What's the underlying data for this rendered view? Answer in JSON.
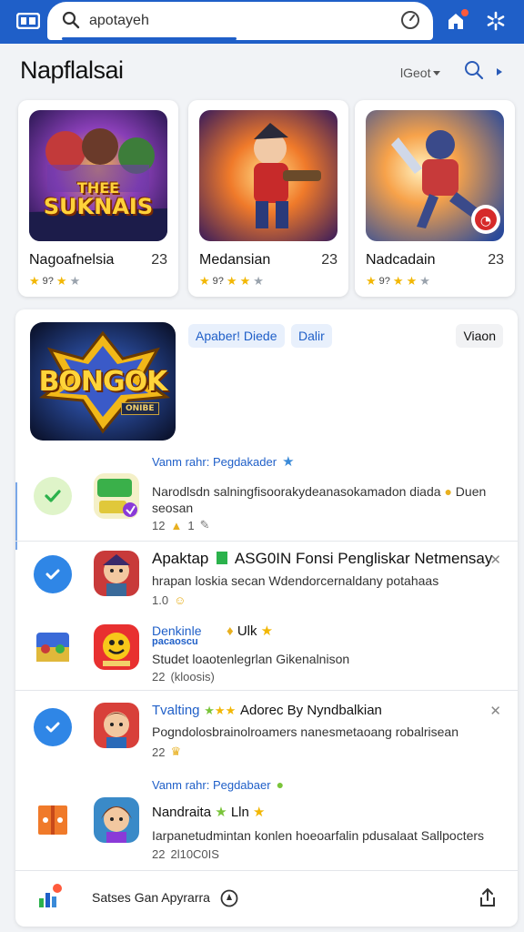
{
  "search": {
    "query": "apotayeh"
  },
  "header": {
    "title": "Napflalsai",
    "sort_label": "lGeot"
  },
  "cards": [
    {
      "name": "Nagoafnelsia",
      "count": "23",
      "meta": "9?"
    },
    {
      "name": "Medansian",
      "count": "23",
      "meta": "9?"
    },
    {
      "name": "Nadcadain",
      "count": "23",
      "meta": "9?"
    }
  ],
  "card_art_text": {
    "card1_line1": "THEE",
    "card1_line2": "SUKNAIS"
  },
  "featured": {
    "chip_1": "Apaber! Diede",
    "chip_2": "Dalir",
    "view_label": "Viaon",
    "art_title": "BONGOK",
    "art_badge": "ONIBE"
  },
  "sections": {
    "sub_1": "Vanm rahr: Pegdakader",
    "sub_2": "Vanm rahr: Pegdabaer"
  },
  "rows": [
    {
      "title": "",
      "desc": "Narodlsdn salningfisoorakydeanasokamadon diada",
      "desc2": "Duen",
      "desc3": "seosan",
      "meta": "12",
      "meta2": "1"
    },
    {
      "title": "Apaktap",
      "title2": "ASG0IN Fonsi Pengliskar Netmensay",
      "desc": "hrapan loskia secan Wdendorcernaldany potahaas",
      "meta": "1.0"
    },
    {
      "title": "Denkinle",
      "title_sub": "pacaoscu",
      "title2": "Ulk",
      "desc": "Studet loaotenlegrlan Gikenalnison",
      "meta": "22",
      "meta2": "(kloosis)"
    },
    {
      "title": "Tvalting",
      "title2": "Adorec By Nyndbalkian",
      "desc": "Pogndolosbrainolroamers nanesmetaoang robalrisean",
      "meta": "22"
    },
    {
      "title": "Nandraita",
      "title2": "Lln",
      "desc": "Iarpanetudmintan konlen hoeoarfalin pdusalaat Sallpocters",
      "meta": "22",
      "meta2": "2l10C0IS"
    }
  ],
  "bottom": {
    "label": "Satses Gan Apyrarra"
  },
  "colors": {
    "brand_blue": "#1f5fc8",
    "star_gold": "#f2b705",
    "check_green": "#2bb24c"
  }
}
